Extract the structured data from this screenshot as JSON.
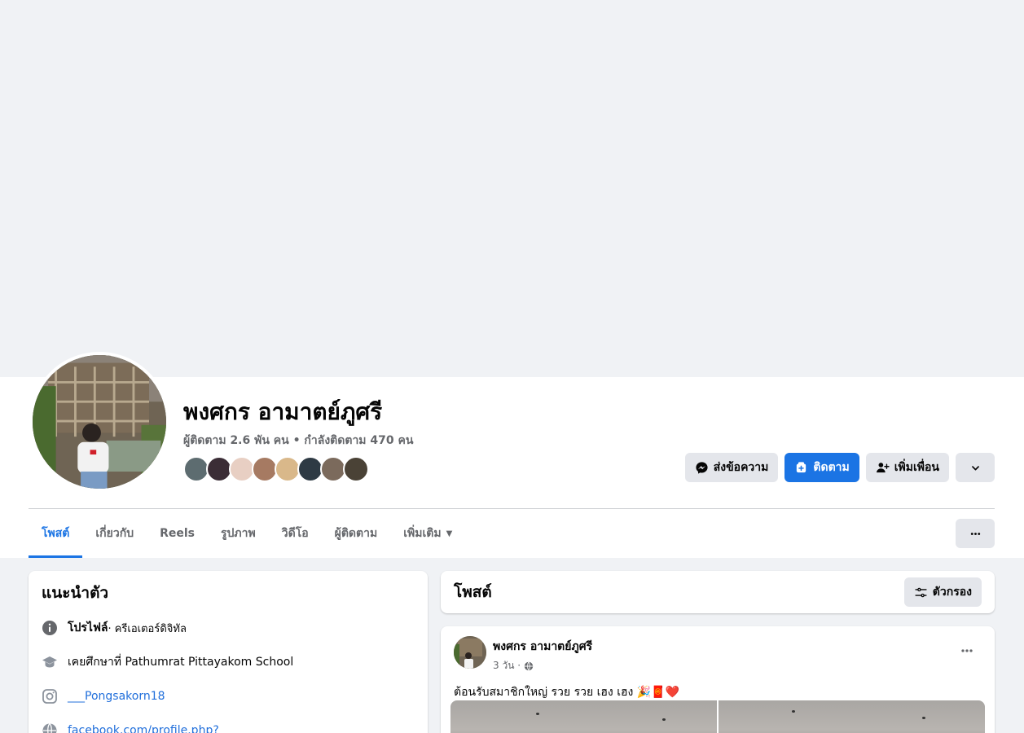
{
  "profile": {
    "name": "พงศกร อามาตย์ภูศรี",
    "stats": "ผู้ติดตาม 2.6 พัน คน • กำลังติดตาม 470 คน"
  },
  "actions": {
    "message_label": "ส่งข้อความ",
    "follow_label": "ติดตาม",
    "add_friend_label": "เพิ่มเพื่อน"
  },
  "tabs": [
    {
      "label": "โพสต์",
      "active": true
    },
    {
      "label": "เกี่ยวกับ"
    },
    {
      "label": "Reels"
    },
    {
      "label": "รูปภาพ"
    },
    {
      "label": "วิดีโอ"
    },
    {
      "label": "ผู้ติดตาม"
    },
    {
      "label": "เพิ่มเติม"
    }
  ],
  "intro": {
    "title": "แนะนำตัว",
    "profile_label": "โปรไฟล์",
    "profile_category": " · ครีเอเตอร์ดิจิทัล",
    "education": "เคยศึกษาที่ Pathumrat Pittayakom School",
    "instagram": "___Pongsakorn18",
    "website": "facebook.com/profile.php?"
  },
  "posts_header": {
    "title": "โพสต์",
    "filter_label": "ตัวกรอง"
  },
  "post": {
    "author": "พงศกร อามาตย์ภูศรี",
    "time": "3 วัน ·",
    "text": "ต้อนรับสมาชิกใหญ่ รวย รวย เฮง เฮง 🎉🧧❤️"
  },
  "colors": {
    "accent": "#1b74e4",
    "button_gray": "#e4e6eb",
    "page_bg": "#f0f2f5",
    "muted_text": "#65676b"
  },
  "icons": {
    "message": "messenger-icon",
    "follow": "follow-icon",
    "add_friend": "person-add-icon",
    "chevron": "chevron-down-icon",
    "more": "more-dots-icon",
    "filter": "filter-icon",
    "info": "info-icon",
    "education": "graduation-cap-icon",
    "instagram": "instagram-icon",
    "website": "globe-icon"
  }
}
